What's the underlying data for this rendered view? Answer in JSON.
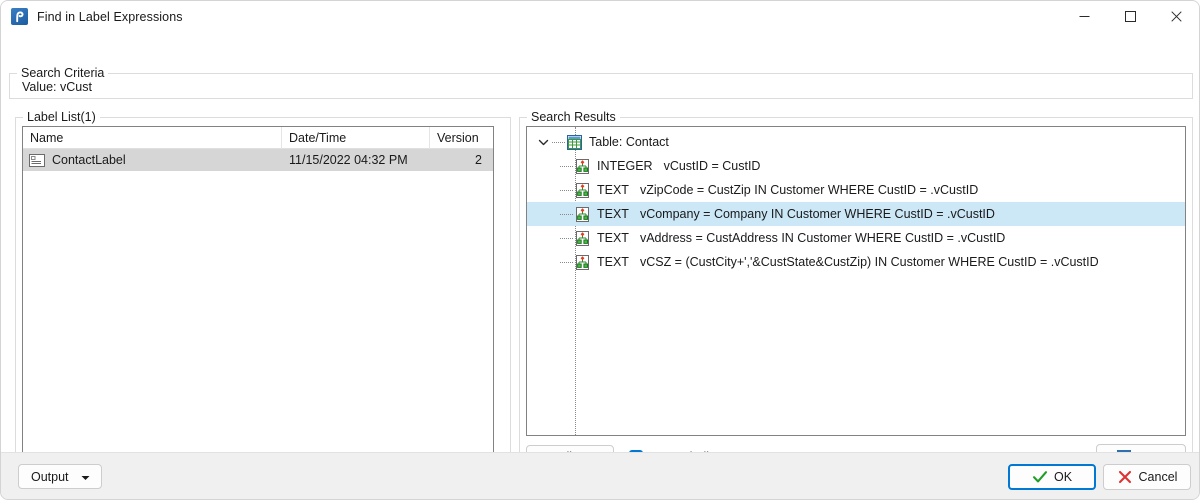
{
  "window": {
    "title": "Find in Label Expressions",
    "icon": "app-icon",
    "controls": {
      "minimize": "minimize-icon",
      "maximize": "maximize-icon",
      "close": "close-icon"
    }
  },
  "search_criteria": {
    "legend": "Search Criteria",
    "value_line": "Value: vCust"
  },
  "label_list": {
    "legend": "Label List(1)",
    "columns": [
      "Name",
      "Date/Time",
      "Version"
    ],
    "rows": [
      {
        "icon": "label-icon",
        "name": "ContactLabel",
        "datetime": "11/15/2022 04:32 PM",
        "version": "2",
        "selected": true
      }
    ]
  },
  "search_results": {
    "legend": "Search Results",
    "root": {
      "icon": "table-icon",
      "label": "Table: Contact",
      "expanded": true,
      "expander_icon": "chevron-down-icon"
    },
    "nodes": [
      {
        "icon": "expression-icon",
        "type": "INTEGER",
        "expression": "vCustID = CustID",
        "selected": false
      },
      {
        "icon": "expression-icon",
        "type": "TEXT",
        "expression": "vZipCode = CustZip IN Customer WHERE CustID = .vCustID",
        "selected": false
      },
      {
        "icon": "expression-icon",
        "type": "TEXT",
        "expression": "vCompany = Company IN Customer WHERE CustID = .vCustID",
        "selected": true
      },
      {
        "icon": "expression-icon",
        "type": "TEXT",
        "expression": "vAddress = CustAddress IN Customer WHERE CustID = .vCustID",
        "selected": false
      },
      {
        "icon": "expression-icon",
        "type": "TEXT",
        "expression": "vCSZ = (CustCity+','&CustState&CustZip) IN Customer WHERE CustID = .vCustID",
        "selected": false
      }
    ],
    "toolbar": {
      "edit_label": "Edit...",
      "expand_all_label": "Expand All",
      "expand_all_checked": true,
      "save_label": "Save",
      "save_icon": "floppy-disk-icon"
    }
  },
  "footer": {
    "output_label": "Output",
    "output_caret_icon": "caret-down-icon",
    "ok_label": "OK",
    "ok_icon": "check-icon",
    "cancel_label": "Cancel",
    "cancel_icon": "cross-icon"
  },
  "colors": {
    "selection": "#cce8f7",
    "list_selection": "#d6d6d6",
    "accent": "#0078d4",
    "ok_check": "#1f9e26",
    "cancel_cross": "#e03131",
    "window_bg": "#f0f0f0"
  }
}
